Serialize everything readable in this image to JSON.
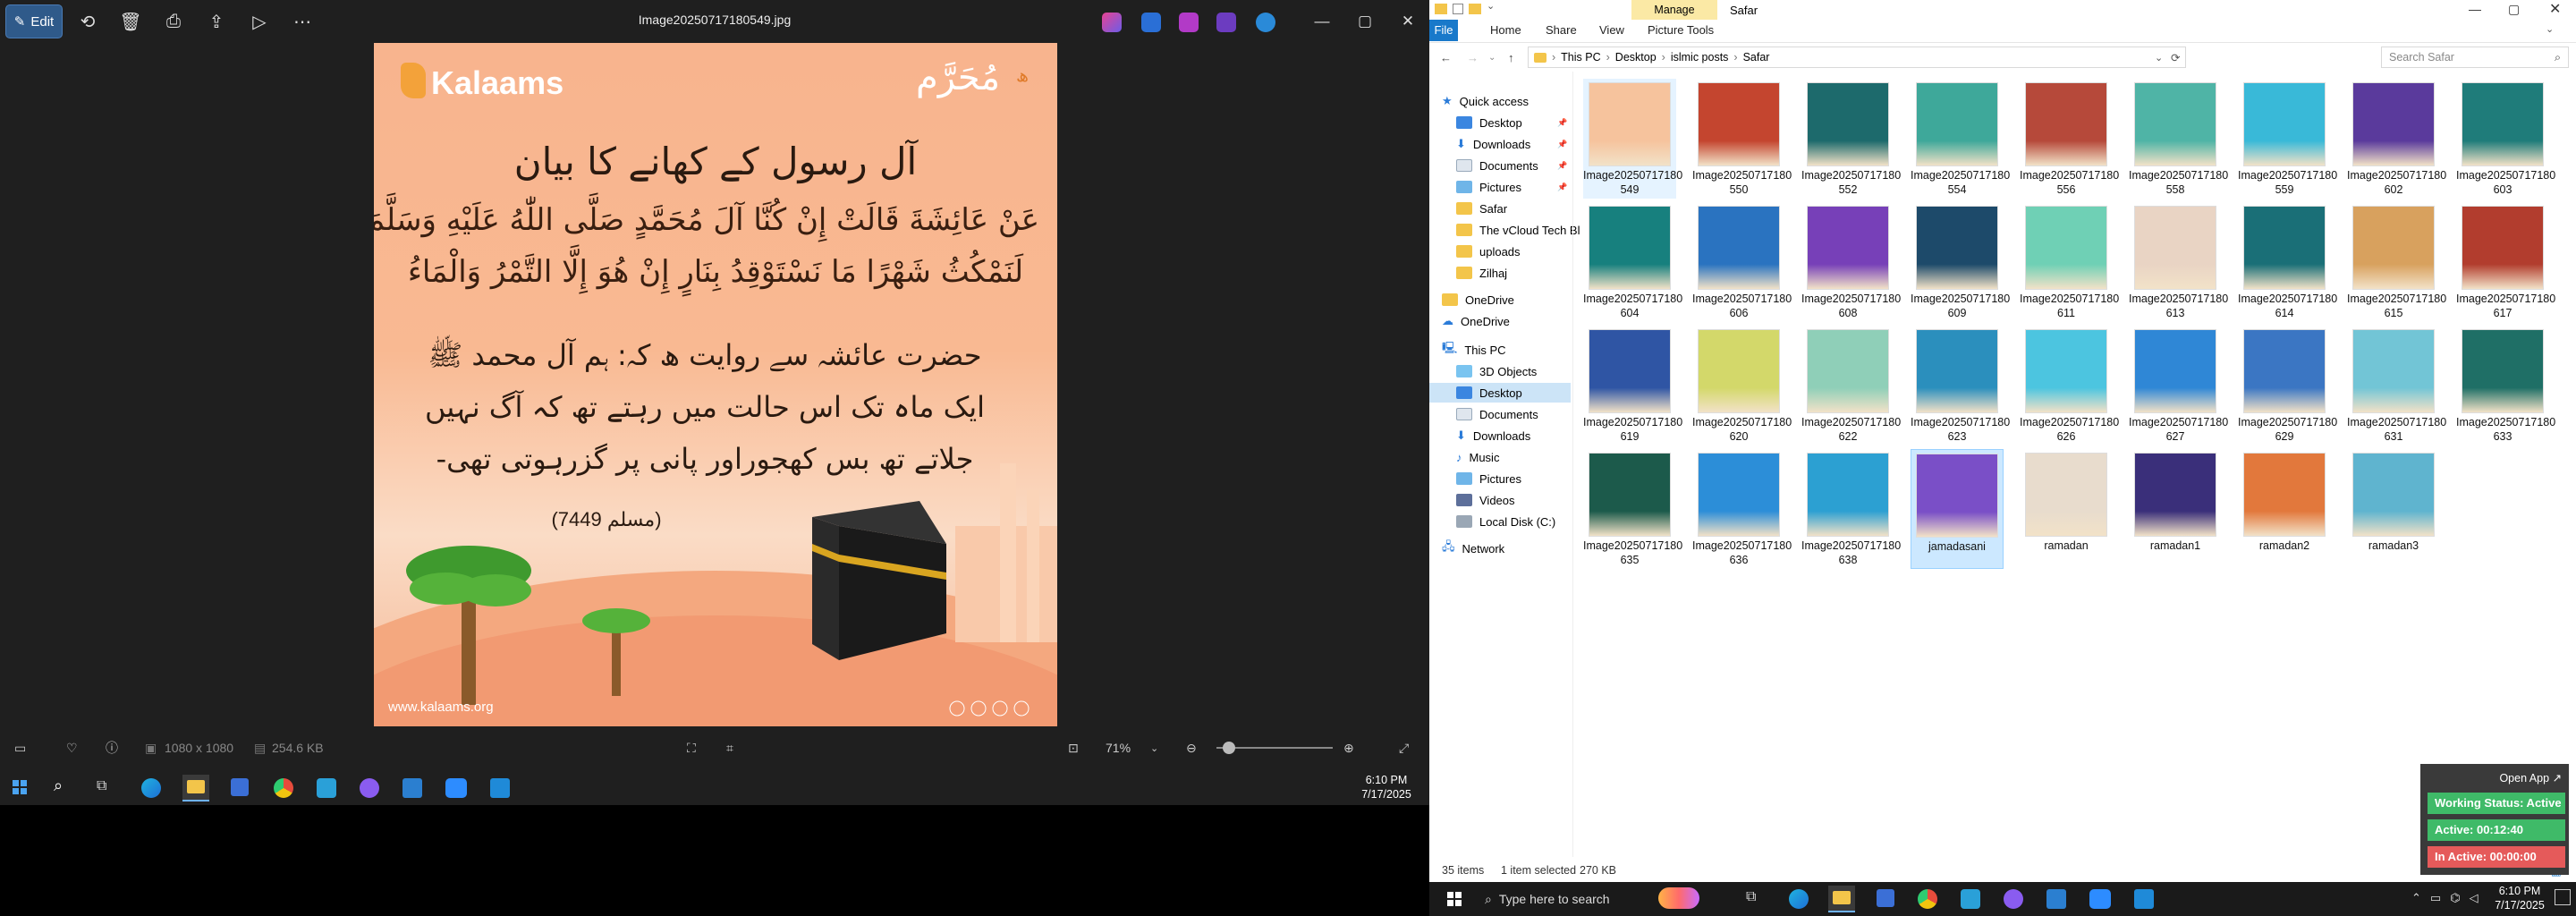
{
  "viewer": {
    "edit_label": "Edit",
    "file_title": "Image20250717180549.jpg",
    "image": {
      "brand": "Kalaams",
      "month_label": "مُحَرَّم",
      "year_label": "ھ",
      "heading": "آل رسول کے کھانے کا بیان",
      "arabic_line1": "عَنْ عَائِشَةَ قَالَتْ إِنْ كُنَّا آلَ مُحَمَّدٍ صَلَّى اللّٰهُ عَلَيْهِ وَسَلَّمَ",
      "arabic_line2": "لَنَمْكُثُ شَهْرًا مَا نَسْتَوْقِدُ بِنَارٍ إِنْ هُوَ إِلَّا التَّمْرُ وَالْمَاءُ",
      "urdu_line1": "حضرت عائشہ سے روایت ھ کہ: ہم آل محمد ﷺ",
      "urdu_line2": "ایک ماہ تک اس حالت میں رہتے تھ کہ آگ نہیں",
      "urdu_line3": "جلاتے تھ بس کھجوراور پانی پر گزرہوتی تھی-",
      "reference": "(مسلم 7449)",
      "website": "www.kalaams.org"
    },
    "dimensions": "1080 x 1080",
    "file_size": "254.6 KB",
    "zoom": "71%",
    "zoom_level": 0.71
  },
  "taskbar_top": {
    "time": "6:10 PM",
    "date": "7/17/2025"
  },
  "explorer": {
    "ribbon_tabs": [
      "File",
      "Home",
      "Share",
      "View",
      "Picture Tools"
    ],
    "manage_label": "Manage",
    "window_title": "Safar",
    "breadcrumb": [
      "This PC",
      "Desktop",
      "islmic posts",
      "Safar"
    ],
    "search_placeholder": "Search Safar",
    "nav": {
      "quick_access": "Quick access",
      "items": [
        {
          "label": "Desktop",
          "pinned": true
        },
        {
          "label": "Downloads",
          "pinned": true
        },
        {
          "label": "Documents",
          "pinned": true
        },
        {
          "label": "Pictures",
          "pinned": true
        },
        {
          "label": "Safar"
        },
        {
          "label": "The vCloud Tech Bl"
        },
        {
          "label": "uploads"
        },
        {
          "label": "Zilhaj"
        }
      ],
      "onedrive1": "OneDrive",
      "onedrive2": "OneDrive",
      "this_pc": "This PC",
      "pc_items": [
        "3D Objects",
        "Desktop",
        "Documents",
        "Downloads",
        "Music",
        "Pictures",
        "Videos",
        "Local Disk (C:)"
      ],
      "network": "Network"
    },
    "files": [
      {
        "l1": "Image20250717180",
        "l2": "549",
        "c": "#f6c39d"
      },
      {
        "l1": "Image20250717180",
        "l2": "550",
        "c": "#c4452f"
      },
      {
        "l1": "Image20250717180",
        "l2": "552",
        "c": "#1d6a6c"
      },
      {
        "l1": "Image20250717180",
        "l2": "554",
        "c": "#3ea89a"
      },
      {
        "l1": "Image20250717180",
        "l2": "556",
        "c": "#b6493a"
      },
      {
        "l1": "Image20250717180",
        "l2": "558",
        "c": "#4fb4a6"
      },
      {
        "l1": "Image20250717180",
        "l2": "559",
        "c": "#39b9d8"
      },
      {
        "l1": "Image20250717180",
        "l2": "602",
        "c": "#5a3a9c"
      },
      {
        "l1": "Image20250717180",
        "l2": "603",
        "c": "#1f7c7a"
      },
      {
        "l1": "Image20250717180",
        "l2": "604",
        "c": "#17807e"
      },
      {
        "l1": "Image20250717180",
        "l2": "606",
        "c": "#2a73c0"
      },
      {
        "l1": "Image20250717180",
        "l2": "608",
        "c": "#7740b8"
      },
      {
        "l1": "Image20250717180",
        "l2": "609",
        "c": "#1d4a6a"
      },
      {
        "l1": "Image20250717180",
        "l2": "611",
        "c": "#6fd0b5"
      },
      {
        "l1": "Image20250717180",
        "l2": "613",
        "c": "#e9d4c4"
      },
      {
        "l1": "Image20250717180",
        "l2": "614",
        "c": "#1a6f77"
      },
      {
        "l1": "Image20250717180",
        "l2": "615",
        "c": "#d8a15e"
      },
      {
        "l1": "Image20250717180",
        "l2": "617",
        "c": "#b23d2e"
      },
      {
        "l1": "Image20250717180",
        "l2": "619",
        "c": "#2f55a4"
      },
      {
        "l1": "Image20250717180",
        "l2": "620",
        "c": "#d3d86a"
      },
      {
        "l1": "Image20250717180",
        "l2": "622",
        "c": "#8fcfb8"
      },
      {
        "l1": "Image20250717180",
        "l2": "623",
        "c": "#2b8fbd"
      },
      {
        "l1": "Image20250717180",
        "l2": "626",
        "c": "#4cc5e0"
      },
      {
        "l1": "Image20250717180",
        "l2": "627",
        "c": "#2f87d6"
      },
      {
        "l1": "Image20250717180",
        "l2": "629",
        "c": "#3b76c3"
      },
      {
        "l1": "Image20250717180",
        "l2": "631",
        "c": "#72c5d6"
      },
      {
        "l1": "Image20250717180",
        "l2": "633",
        "c": "#1f6f66"
      },
      {
        "l1": "Image20250717180",
        "l2": "635",
        "c": "#1c5a4b"
      },
      {
        "l1": "Image20250717180",
        "l2": "636",
        "c": "#2c8ed8"
      },
      {
        "l1": "Image20250717180",
        "l2": "638",
        "c": "#2ca0d2"
      },
      {
        "l1": "jamadasani",
        "l2": "",
        "c": "#7a4fc7",
        "selected": true
      },
      {
        "l1": "ramadan",
        "l2": "",
        "c": "#e8dccd"
      },
      {
        "l1": "ramadan1",
        "l2": "",
        "c": "#3a2f7a"
      },
      {
        "l1": "ramadan2",
        "l2": "",
        "c": "#e2783c"
      },
      {
        "l1": "ramadan3",
        "l2": "",
        "c": "#5fb4cf"
      }
    ],
    "status_items": "35 items",
    "status_selected": "1 item selected",
    "status_size": "270 KB"
  },
  "widget": {
    "open_app": "Open App",
    "status": "Working Status: Active",
    "active": "Active: 00:12:40",
    "inactive": "In Active: 00:00:00"
  },
  "taskbar_bottom": {
    "search_placeholder": "Type here to search",
    "time": "6:10 PM",
    "date": "7/17/2025"
  },
  "colors": {
    "accent": "#0067c0",
    "widget_active": "#3fba68",
    "widget_inactive": "#e55a5a"
  }
}
